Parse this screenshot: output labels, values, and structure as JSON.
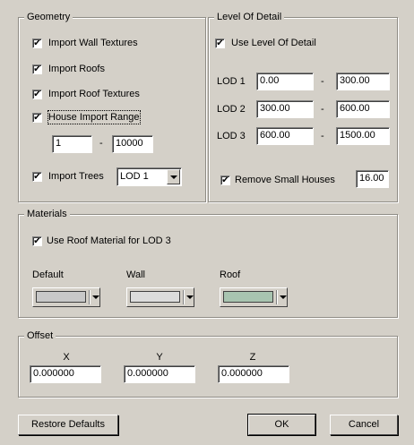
{
  "geometry": {
    "title": "Geometry",
    "import_wall_textures": {
      "label": "Import Wall Textures",
      "checked": "✔"
    },
    "import_roofs": {
      "label": "Import Roofs",
      "checked": "✔"
    },
    "import_roof_textures": {
      "label": "Import Roof Textures",
      "checked": "✔"
    },
    "house_import_range": {
      "label": "House Import Range",
      "checked": "✔",
      "from": "1",
      "sep": "-",
      "to": "10000"
    },
    "import_trees": {
      "label": "Import Trees",
      "checked": "✔",
      "lod": "LOD 1"
    }
  },
  "level_of_detail": {
    "title": "Level Of Detail",
    "use_lod": {
      "label": "Use Level Of Detail",
      "checked": "✔"
    },
    "rows": [
      {
        "label": "LOD 1",
        "from": "0.00",
        "sep": "-",
        "to": "300.00"
      },
      {
        "label": "LOD 2",
        "from": "300.00",
        "sep": "-",
        "to": "600.00"
      },
      {
        "label": "LOD 3",
        "from": "600.00",
        "sep": "-",
        "to": "1500.00"
      }
    ],
    "remove_small_houses": {
      "label": "Remove Small Houses",
      "checked": "✔",
      "value": "16.00"
    }
  },
  "materials": {
    "title": "Materials",
    "use_roof_material": {
      "label": "Use Roof Material for LOD 3",
      "checked": "✔"
    },
    "default": {
      "label": "Default",
      "color": "#c8c8c8"
    },
    "wall": {
      "label": "Wall",
      "color": "#dcdcdc"
    },
    "roof": {
      "label": "Roof",
      "color": "#a8c4b0"
    }
  },
  "offset": {
    "title": "Offset",
    "x": {
      "label": "X",
      "value": "0.000000"
    },
    "y": {
      "label": "Y",
      "value": "0.000000"
    },
    "z": {
      "label": "Z",
      "value": "0.000000"
    }
  },
  "buttons": {
    "restore": "Restore Defaults",
    "ok": "OK",
    "cancel": "Cancel"
  }
}
